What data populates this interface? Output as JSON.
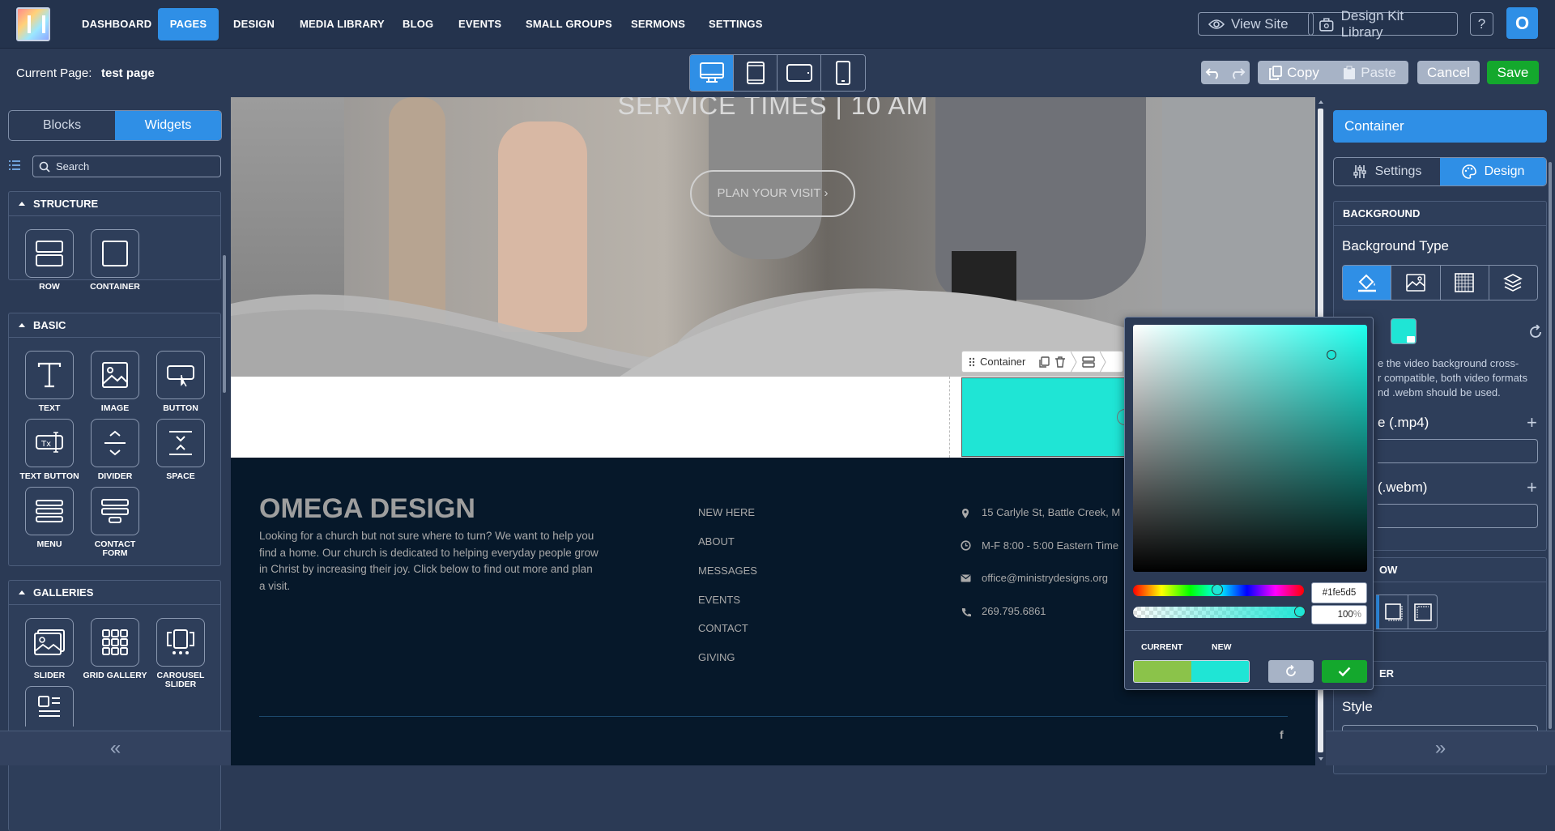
{
  "nav": {
    "items": [
      {
        "label": "DASHBOARD",
        "active": false
      },
      {
        "label": "PAGES",
        "active": true
      },
      {
        "label": "DESIGN",
        "active": false
      },
      {
        "label": "MEDIA LIBRARY",
        "active": false
      },
      {
        "label": "BLOG",
        "active": false
      },
      {
        "label": "EVENTS",
        "active": false
      },
      {
        "label": "SMALL GROUPS",
        "active": false
      },
      {
        "label": "SERMONS",
        "active": false
      },
      {
        "label": "SETTINGS",
        "active": false
      }
    ],
    "view_site": "View Site",
    "design_kit": "Design Kit Library",
    "help": "?",
    "avatar": "O"
  },
  "toolbar": {
    "current_page_label": "Current Page:",
    "current_page_value": "test page",
    "copy": "Copy",
    "paste": "Paste",
    "cancel": "Cancel",
    "save": "Save"
  },
  "left": {
    "tabs": [
      "Blocks",
      "Widgets"
    ],
    "search_placeholder": "Search",
    "sections": [
      {
        "title": "STRUCTURE",
        "widgets": [
          "ROW",
          "CONTAINER"
        ]
      },
      {
        "title": "BASIC",
        "widgets": [
          "TEXT",
          "IMAGE",
          "BUTTON",
          "TEXT BUTTON",
          "DIVIDER",
          "SPACE",
          "MENU",
          "CONTACT FORM"
        ]
      },
      {
        "title": "GALLERIES",
        "widgets": [
          "SLIDER",
          "GRID GALLERY",
          "CAROUSEL SLIDER"
        ]
      }
    ]
  },
  "hero": {
    "service_times": "SERVICE TIMES | 10 AM",
    "cta": "PLAN YOUR VISIT ›"
  },
  "container_toolbar": {
    "label": "Container"
  },
  "footer": {
    "brand": "OMEGA DESIGN",
    "blurb": "Looking for a church but not sure where to turn? We want to help you find a home. Our church is dedicated to helping everyday people grow in Christ by increasing their joy.  Click below to find out more and plan a visit.",
    "links": [
      "NEW HERE",
      "ABOUT",
      "MESSAGES",
      "EVENTS",
      "CONTACT",
      "GIVING"
    ],
    "contact": [
      "15 Carlyle St, Battle Creek, M",
      "M-F 8:00 - 5:00 Eastern Time",
      "office@ministrydesigns.org",
      "269.795.6861"
    ],
    "social": "f"
  },
  "right": {
    "header": "Container",
    "tabs": [
      "Settings",
      "Design"
    ],
    "background_section": "BACKGROUND",
    "background_type_label": "Background Type",
    "video_note": "e the video background cross-\nr compatible, both video formats\nnd .webm should be used.",
    "mp4_label": "e (.mp4)",
    "webm_label": "(.webm)",
    "shadow_section": "OW",
    "border_section": "ER",
    "style_label": "Style"
  },
  "picker": {
    "hex": "#1fe5d5",
    "alpha": "100",
    "alpha_unit": "%",
    "current_label": "CURRENT",
    "new_label": "NEW"
  },
  "colors": {
    "accent": "#2f8fe6",
    "save_green": "#14a82d",
    "current_color": "#8bc34a",
    "new_color": "#1fe5d5"
  }
}
